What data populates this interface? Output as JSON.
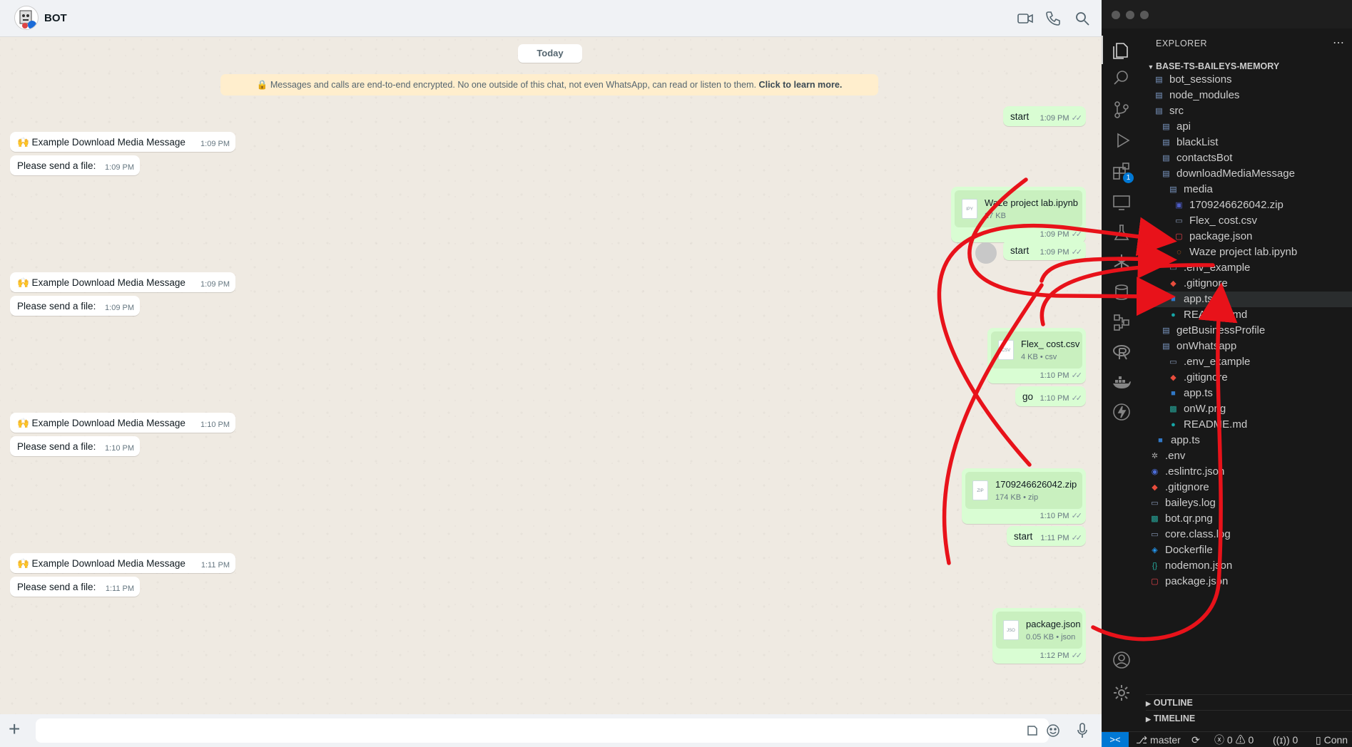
{
  "whatsapp": {
    "contact_name": "BOT",
    "date_chip": "Today",
    "encryption_notice": "Messages and calls are end-to-end encrypted. No one outside of this chat, not even WhatsApp, can read or listen to them.",
    "encryption_link": "Click to learn more.",
    "messages": [
      {
        "text": "start",
        "time": "1:09 PM"
      },
      {
        "text": "🙌 Example Download Media Message",
        "time": "1:09 PM"
      },
      {
        "text": "Please send a file:",
        "time": "1:09 PM"
      },
      {
        "file_name": "Waze project lab.ipynb",
        "file_meta": "27 KB",
        "file_type": "IPY",
        "time": "1:09 PM"
      },
      {
        "text": "start",
        "time": "1:09 PM"
      },
      {
        "text": "🙌 Example Download Media Message",
        "time": "1:09 PM"
      },
      {
        "text": "Please send a file:",
        "time": "1:09 PM"
      },
      {
        "file_name": "Flex_ cost.csv",
        "file_meta": "4 KB • csv",
        "file_type": "CSV",
        "time": "1:10 PM"
      },
      {
        "text": "go",
        "time": "1:10 PM"
      },
      {
        "text": "🙌 Example Download Media Message",
        "time": "1:10 PM"
      },
      {
        "text": "Please send a file:",
        "time": "1:10 PM"
      },
      {
        "file_name": "1709246626042.zip",
        "file_meta": "174 KB • zip",
        "file_type": "ZIP",
        "time": "1:10 PM"
      },
      {
        "text": "start",
        "time": "1:11 PM"
      },
      {
        "text": "🙌 Example Download Media Message",
        "time": "1:11 PM"
      },
      {
        "text": "Please send a file:",
        "time": "1:11 PM"
      },
      {
        "file_name": "package.json",
        "file_meta": "0.05 KB • json",
        "file_type": "JSO",
        "time": "1:12 PM"
      }
    ],
    "input_placeholder": ""
  },
  "vscode": {
    "explorer_title": "EXPLORER",
    "project_name": "BASE-TS-BAILEYS-MEMORY",
    "tree": [
      {
        "label": "bot_sessions",
        "icon": "folder-icon"
      },
      {
        "label": "node_modules",
        "icon": "folder-icon"
      },
      {
        "label": "src",
        "icon": "folder-icon"
      },
      {
        "label": "api",
        "icon": "folder-icon"
      },
      {
        "label": "blackList",
        "icon": "folder-icon"
      },
      {
        "label": "contactsBot",
        "icon": "folder-icon"
      },
      {
        "label": "downloadMediaMessage",
        "icon": "folder-icon"
      },
      {
        "label": "media",
        "icon": "folder-icon"
      },
      {
        "label": "1709246626042.zip",
        "icon": "zip-file-icon"
      },
      {
        "label": "Flex_ cost.csv",
        "icon": "file-icon"
      },
      {
        "label": "package.json",
        "icon": "npm-icon"
      },
      {
        "label": "Waze project lab.ipynb",
        "icon": "jupyter-icon"
      },
      {
        "label": ".env_example",
        "icon": "file-icon"
      },
      {
        "label": ".gitignore",
        "icon": "git-icon"
      },
      {
        "label": "app.ts",
        "icon": "typescript-icon"
      },
      {
        "label": "README.md",
        "icon": "info-icon"
      },
      {
        "label": "getBusinessProfile",
        "icon": "folder-icon"
      },
      {
        "label": "onWhatsapp",
        "icon": "folder-icon"
      },
      {
        "label": ".env_example",
        "icon": "file-icon"
      },
      {
        "label": ".gitignore",
        "icon": "git-icon"
      },
      {
        "label": "app.ts",
        "icon": "typescript-icon"
      },
      {
        "label": "onW.png",
        "icon": "image-icon"
      },
      {
        "label": "README.md",
        "icon": "info-icon"
      },
      {
        "label": "app.ts",
        "icon": "typescript-icon"
      },
      {
        "label": ".env",
        "icon": "gear-icon"
      },
      {
        "label": ".eslintrc.json",
        "icon": "eslint-icon"
      },
      {
        "label": ".gitignore",
        "icon": "git-icon"
      },
      {
        "label": "baileys.log",
        "icon": "file-icon"
      },
      {
        "label": "bot.qr.png",
        "icon": "image-icon"
      },
      {
        "label": "core.class.log",
        "icon": "file-icon"
      },
      {
        "label": "Dockerfile",
        "icon": "docker-icon"
      },
      {
        "label": "nodemon.json",
        "icon": "json-icon"
      },
      {
        "label": "package.json",
        "icon": "npm-icon"
      }
    ],
    "outline_label": "OUTLINE",
    "timeline_label": "TIMELINE",
    "status": {
      "branch": "master",
      "errors": "0",
      "warnings": "0",
      "ports": "0",
      "tail": "Conn"
    },
    "activity_badge": "1"
  },
  "colors": {
    "arrow": "#e8121a",
    "outgoing_bubble": "#d9fdd3",
    "vscode_bg": "#181818",
    "folder": "#7e9bc7"
  }
}
